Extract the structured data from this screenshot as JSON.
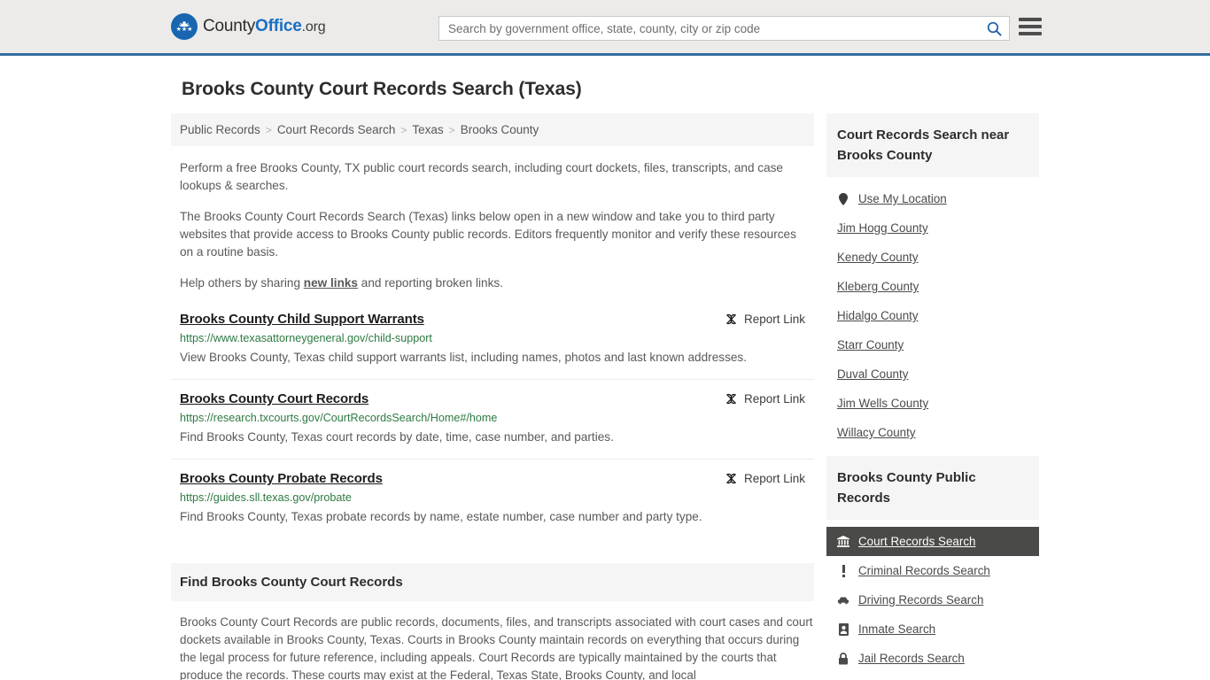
{
  "header": {
    "logo": {
      "part1": "County",
      "part2": "Office",
      "part3": ".org",
      "icon": "eagle-badge-icon"
    },
    "search": {
      "placeholder": "Search by government office, state, county, city or zip code",
      "value": "",
      "icon": "search-icon"
    },
    "menu_icon": "hamburger-menu-icon"
  },
  "page": {
    "title": "Brooks County Court Records Search (Texas)"
  },
  "breadcrumb": {
    "separator": ">",
    "items": [
      {
        "label": "Public Records"
      },
      {
        "label": "Court Records Search"
      },
      {
        "label": "Texas"
      },
      {
        "label": "Brooks County"
      }
    ]
  },
  "intro": {
    "p1": "Perform a free Brooks County, TX public court records search, including court dockets, files, transcripts, and case lookups & searches.",
    "p2": "The Brooks County Court Records Search (Texas) links below open in a new window and take you to third party websites that provide access to Brooks County public records. Editors frequently monitor and verify these resources on a routine basis.",
    "p3_before": "Help others by sharing ",
    "p3_link": "new links",
    "p3_after": " and reporting broken links."
  },
  "report_link_label": "Report Link",
  "report_link_icon": "broken-link-icon",
  "entries": [
    {
      "title": "Brooks County Child Support Warrants",
      "url": "https://www.texasattorneygeneral.gov/child-support",
      "description": "View Brooks County, Texas child support warrants list, including names, photos and last known addresses."
    },
    {
      "title": "Brooks County Court Records",
      "url": "https://research.txcourts.gov/CourtRecordsSearch/Home#/home",
      "description": "Find Brooks County, Texas court records by date, time, case number, and parties."
    },
    {
      "title": "Brooks County Probate Records",
      "url": "https://guides.sll.texas.gov/probate",
      "description": "Find Brooks County, Texas probate records by name, estate number, case number and party type."
    }
  ],
  "find_section": {
    "heading": "Find Brooks County Court Records",
    "body": "Brooks County Court Records are public records, documents, files, and transcripts associated with court cases and court dockets available in Brooks County, Texas. Courts in Brooks County maintain records on everything that occurs during the legal process for future reference, including appeals. Court Records are typically maintained by the courts that produce the records. These courts may exist at the Federal, Texas State, Brooks County, and local"
  },
  "sidebar": {
    "nearby": {
      "heading": "Court Records Search near Brooks County",
      "items": [
        {
          "label": "Use My Location",
          "icon": "map-pin-icon"
        },
        {
          "label": "Jim Hogg County",
          "icon": ""
        },
        {
          "label": "Kenedy County",
          "icon": ""
        },
        {
          "label": "Kleberg County",
          "icon": ""
        },
        {
          "label": "Hidalgo County",
          "icon": ""
        },
        {
          "label": "Starr County",
          "icon": ""
        },
        {
          "label": "Duval County",
          "icon": ""
        },
        {
          "label": "Jim Wells County",
          "icon": ""
        },
        {
          "label": "Willacy County",
          "icon": ""
        }
      ]
    },
    "public_records": {
      "heading": "Brooks County Public Records",
      "items": [
        {
          "label": "Court Records Search",
          "icon": "bank-icon",
          "active": true
        },
        {
          "label": "Criminal Records Search",
          "icon": "exclamation-icon",
          "active": false
        },
        {
          "label": "Driving Records Search",
          "icon": "car-icon",
          "active": false
        },
        {
          "label": "Inmate Search",
          "icon": "id-card-icon",
          "active": false
        },
        {
          "label": "Jail Records Search",
          "icon": "lock-icon",
          "active": false
        }
      ]
    }
  },
  "colors": {
    "header_bg": "#ecebe9",
    "header_border": "#336d9e",
    "logo_blue": "#1a6fc4",
    "url_green": "#2d7a42",
    "active_bg": "#4a4a48",
    "panel_bg": "#f5f5f5"
  }
}
